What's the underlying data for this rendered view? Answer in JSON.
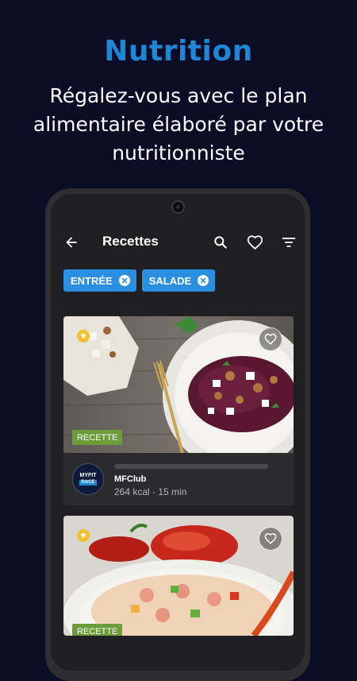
{
  "hero": {
    "title": "Nutrition",
    "subtitle": "Régalez-vous avec le plan alimentaire élaboré par votre nutritionniste"
  },
  "appbar": {
    "back_icon": "arrow-left-icon",
    "title": "Recettes",
    "search_icon": "search-icon",
    "favorites_icon": "heart-icon",
    "filter_icon": "filter-icon"
  },
  "filters": [
    {
      "label": "ENTRÉE",
      "remove_icon": "close-circle-icon"
    },
    {
      "label": "SALADE",
      "remove_icon": "close-circle-icon"
    }
  ],
  "recipes": [
    {
      "image": "beetroot-feta-walnut-salad",
      "tag": "RECETTE",
      "author": "MFClub",
      "meta": "264 kcal · 15 min",
      "avatar_top": "MYFIT",
      "avatar_bottom": "RACE"
    },
    {
      "image": "shrimp-rice-salad",
      "tag": "RECETTE"
    }
  ],
  "colors": {
    "background": "#0b0c26",
    "accent": "#1e86d4",
    "chip": "#2a8fe0",
    "tag": "#6d9d3a",
    "card": "#2b2b2e",
    "screen": "#1f1f21"
  }
}
